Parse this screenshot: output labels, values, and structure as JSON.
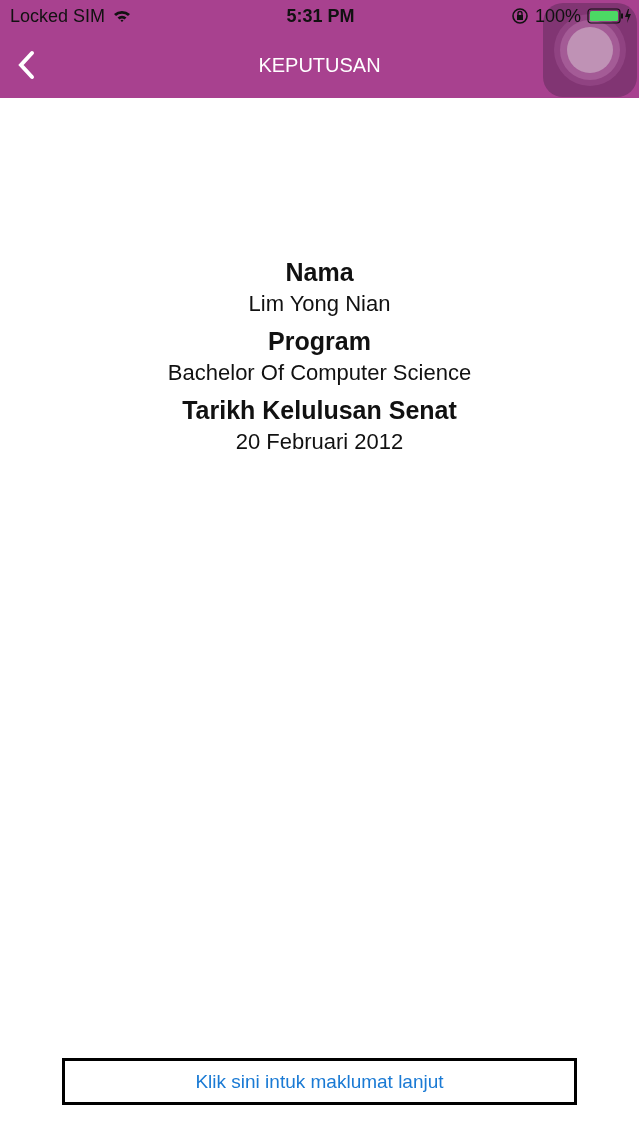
{
  "status_bar": {
    "carrier": "Locked SIM",
    "time": "5:31 PM",
    "battery": "100%"
  },
  "nav": {
    "title": "KEPUTUSAN"
  },
  "fields": [
    {
      "label": "Nama",
      "value": "Lim Yong Nian"
    },
    {
      "label": "Program",
      "value": "Bachelor Of Computer Science"
    },
    {
      "label": "Tarikh Kelulusan Senat",
      "value": "20 Februari 2012"
    }
  ],
  "link_button": {
    "label": "Klik sini intuk maklumat lanjut"
  }
}
